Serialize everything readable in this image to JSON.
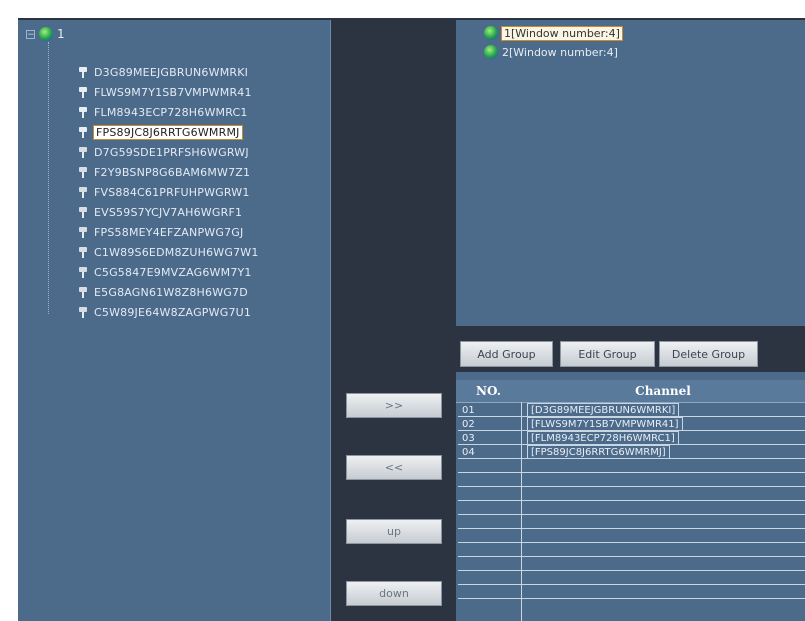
{
  "tree": {
    "root_label": "1",
    "expander": "−",
    "items": [
      {
        "label": "D3G89MEEJGBRUN6WMRKI",
        "state": "online"
      },
      {
        "label": "FLWS9M7Y1SB7VMPWMR41",
        "state": "online"
      },
      {
        "label": "FLM8943ECP728H6WMRC1",
        "state": "online"
      },
      {
        "label": "FPS89JC8J6RRTG6WMRMJ",
        "state": "online",
        "selected": true
      },
      {
        "label": "D7G59SDE1PRFSH6WGRWJ",
        "state": "offline"
      },
      {
        "label": "F2Y9BSNP8G6BAM6MW7Z1",
        "state": "offline"
      },
      {
        "label": "FVS884C61PRFUHPWGRW1",
        "state": "offline"
      },
      {
        "label": "EVS59S7YCJV7AH6WGRF1",
        "state": "offline"
      },
      {
        "label": "FPS58MEY4EFZANPWG7GJ",
        "state": "offline"
      },
      {
        "label": "C1W89S6EDM8ZUH6WG7W1",
        "state": "offline"
      },
      {
        "label": "C5G5847E9MVZAG6WM7Y1",
        "state": "offline"
      },
      {
        "label": "E5G8AGN61W8Z8H6WG7D",
        "state": "offline"
      },
      {
        "label": "C5W89JE64W8ZAGPWG7U1",
        "state": "offline"
      }
    ]
  },
  "windows": {
    "items": [
      {
        "label": "1[Window number:4]",
        "selected": true
      },
      {
        "label": "2[Window number:4]",
        "selected": false
      }
    ]
  },
  "transfer_buttons": {
    "add": ">>",
    "remove": "<<",
    "up": "up",
    "down": "down"
  },
  "group_buttons": {
    "add": "Add Group",
    "edit": "Edit Group",
    "delete": "Delete Group"
  },
  "channel_table": {
    "columns": [
      "NO.",
      "Channel"
    ],
    "rows": [
      {
        "no": "01",
        "channel": "[D3G89MEEJGBRUN6WMRKI]"
      },
      {
        "no": "02",
        "channel": "[FLWS9M7Y1SB7VMPWMR41]"
      },
      {
        "no": "03",
        "channel": "[FLM8943ECP728H6WMRC1]"
      },
      {
        "no": "04",
        "channel": "[FPS89JC8J6RRTG6WMRMJ]"
      }
    ]
  },
  "colors": {
    "panel": "#4c6a8a",
    "background": "#2b3440",
    "selection_outline": "#c98b2e"
  }
}
